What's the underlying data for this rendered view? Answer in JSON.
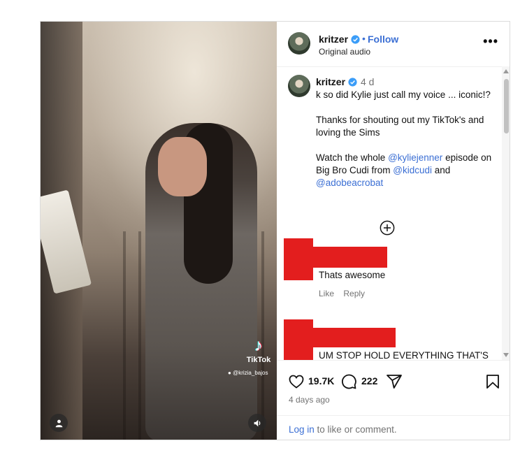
{
  "post": {
    "media": {
      "watermark_brand": "TikTok",
      "watermark_user": "@krizia_bajos"
    },
    "header": {
      "username": "kritzer",
      "separator": "•",
      "follow_label": "Follow",
      "subtitle": "Original audio",
      "more_label": "•••"
    },
    "caption": {
      "username": "kritzer",
      "time": "4 d",
      "line1": "k so did Kylie just call my voice ... iconic!?",
      "line2": "Thanks for shouting out my TikTok's and loving the Sims",
      "line3_pre": "Watch the whole ",
      "mention1": "@kyliejenner",
      "line3_mid": " episode on Big Bro Cudi from ",
      "mention2": "@kidcudi",
      "line3_and": " and ",
      "mention3": "@adobeacrobat"
    },
    "comments": [
      {
        "text": "Thats awesome",
        "like_label": "Like",
        "reply_label": "Reply"
      },
      {
        "text": "UM STOP HOLD EVERYTHING THAT'S DEAR BC I'M A SIMS ADDICT AND I DIDN'T EXPERIENCE THE COVID"
      }
    ],
    "actions": {
      "likes": "19.7K",
      "comments": "222",
      "posted": "4 days ago",
      "login_link": "Log in",
      "login_rest": " to like or comment."
    },
    "colors": {
      "accent": "#3b6fd4",
      "redaction": "#e31e1e",
      "muted": "#737373"
    }
  }
}
